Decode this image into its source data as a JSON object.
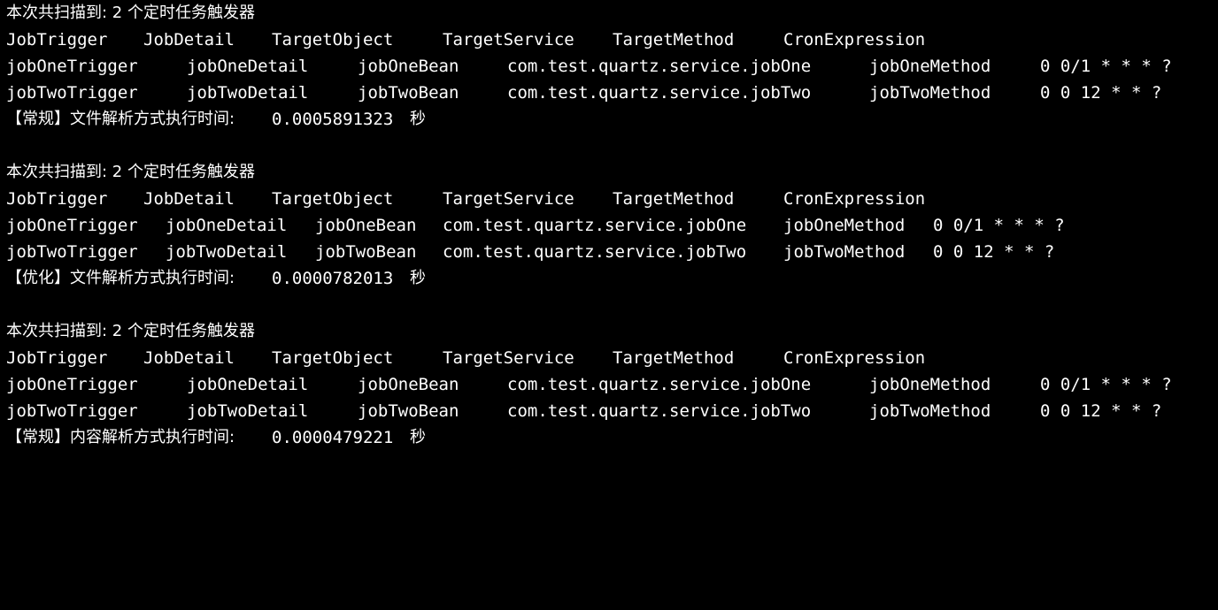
{
  "terminal": {
    "text_color": "#ffffff",
    "background": "#000000",
    "blocks": [
      {
        "summary": "本次共扫描到: 2 个定时任务触发器",
        "header": [
          "JobTrigger",
          "JobDetail",
          "TargetObject",
          "TargetService",
          "TargetMethod",
          "CronExpression"
        ],
        "rows": [
          [
            "jobOneTrigger",
            "jobOneDetail",
            "jobOneBean",
            "com.test.quartz.service.jobOne",
            "jobOneMethod",
            "0 0/1 * * * ?"
          ],
          [
            "jobTwoTrigger",
            "jobTwoDetail",
            "jobTwoBean",
            "com.test.quartz.service.jobTwo",
            "jobTwoMethod",
            "0 0 12 * * ?"
          ]
        ],
        "timing_label": "【常规】文件解析方式执行时间:",
        "timing_value": "0.0005891323",
        "timing_unit": "秒"
      },
      {
        "summary": "本次共扫描到: 2 个定时任务触发器",
        "header": [
          "JobTrigger",
          "JobDetail",
          "TargetObject",
          "TargetService",
          "TargetMethod",
          "CronExpression"
        ],
        "rows": [
          [
            "jobOneTrigger",
            "jobOneDetail",
            "jobOneBean",
            "com.test.quartz.service.jobOne",
            "jobOneMethod",
            "0 0/1 * * * ?"
          ],
          [
            "jobTwoTrigger",
            "jobTwoDetail",
            "jobTwoBean",
            "com.test.quartz.service.jobTwo",
            "jobTwoMethod",
            "0 0 12 * * ?"
          ]
        ],
        "timing_label": "【优化】文件解析方式执行时间:",
        "timing_value": "0.0000782013",
        "timing_unit": "秒"
      },
      {
        "summary": "本次共扫描到: 2 个定时任务触发器",
        "header": [
          "JobTrigger",
          "JobDetail",
          "TargetObject",
          "TargetService",
          "TargetMethod",
          "CronExpression"
        ],
        "rows": [
          [
            "jobOneTrigger",
            "jobOneDetail",
            "jobOneBean",
            "com.test.quartz.service.jobOne",
            "jobOneMethod",
            "0 0/1 * * * ?"
          ],
          [
            "jobTwoTrigger",
            "jobTwoDetail",
            "jobTwoBean",
            "com.test.quartz.service.jobTwo",
            "jobTwoMethod",
            "0 0 12 * * ?"
          ]
        ],
        "timing_label": "【常规】内容解析方式执行时间:",
        "timing_value": "0.0000479221",
        "timing_unit": "秒"
      }
    ]
  }
}
